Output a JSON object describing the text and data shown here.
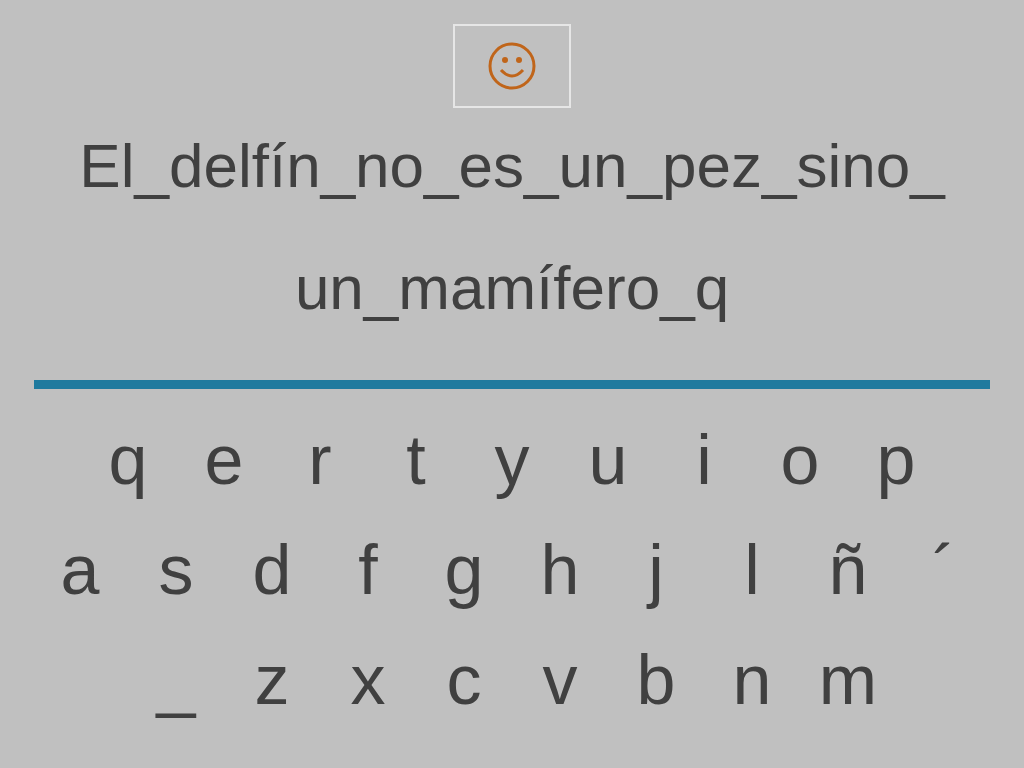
{
  "answer_lines": [
    "El_delfín_no_es_un_pez_sino_",
    "un_mamífero_q"
  ],
  "keyboard_rows": [
    [
      "q",
      "e",
      "r",
      "t",
      "y",
      "u",
      "i",
      "o",
      "p"
    ],
    [
      "a",
      "s",
      "d",
      "f",
      "g",
      "h",
      "j",
      "l",
      "ñ",
      "´"
    ],
    [
      "_",
      "z",
      "x",
      "c",
      "v",
      "b",
      "n",
      "m"
    ]
  ]
}
